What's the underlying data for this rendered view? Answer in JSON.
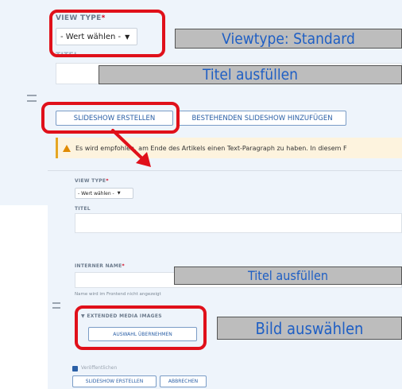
{
  "top_form": {
    "view_type_label": "VIEW TYPE",
    "required_mark": "*",
    "view_type_value": "- Wert wählen -",
    "title_label": "TITEL",
    "btn_create_slideshow": "SLIDESHOW ERSTELLEN",
    "btn_add_existing": "BESTEHENDEN SLIDESHOW HINZUFÜGEN",
    "warning": "Es wird empfohlen, am Ende des Artikels einen Text-Paragraph zu haben. In diesem F"
  },
  "bottom_form": {
    "view_type_label": "VIEW TYPE",
    "required_mark": "*",
    "view_type_value": "- Wert wählen -",
    "title_label": "TITEL",
    "internal_name_label": "INTERNER NAME",
    "internal_name_help": "Name wird im Frontend nicht angezeigt",
    "media_section": "EXTENDED MEDIA IMAGES",
    "btn_apply_selection": "AUSWAHL ÜBERNEHMEN",
    "published_label": "Veröffentlichen",
    "btn_create_slideshow": "SLIDESHOW ERSTELLEN",
    "btn_cancel": "ABBRECHEN"
  },
  "annotations": {
    "viewtype": "Viewtype: Standard",
    "title_fill_1": "Titel ausfüllen",
    "title_fill_2": "Titel ausfüllen",
    "choose_image": "Bild auswählen"
  },
  "colors": {
    "panel_bg": "#eef4fb",
    "callout_red": "#e0101a",
    "note_gray": "#bdbdbd",
    "note_text_blue": "#1f5fc4",
    "button_blue": "#2a5fa6",
    "warning_bg": "#fdf3de"
  },
  "icons": {
    "dropdown": "caret-down",
    "warning": "warning-triangle",
    "drag": "drag-handle",
    "collapse": "caret-down",
    "checkbox": "checked-box"
  }
}
